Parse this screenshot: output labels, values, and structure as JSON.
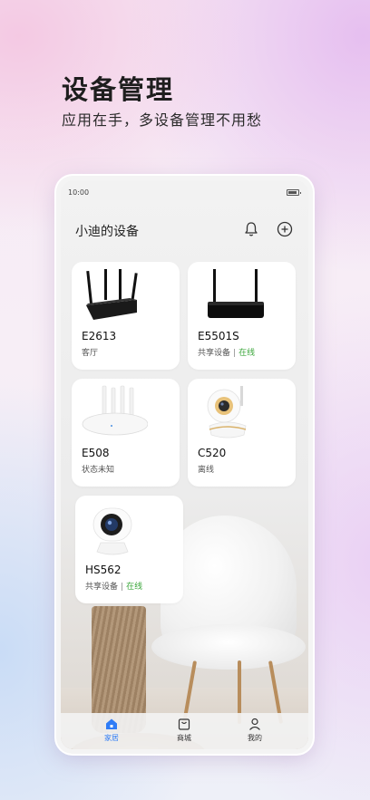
{
  "hero": {
    "title": "设备管理",
    "subtitle": "应用在手，多设备管理不用愁"
  },
  "status_bar": {
    "time": "10:00"
  },
  "header": {
    "title": "小迪的设备",
    "bell_icon": "bell-icon",
    "add_icon": "add-circle-icon"
  },
  "devices": [
    {
      "name": "E2613",
      "status": "客厅",
      "online": "",
      "image": "router-4-antenna-black"
    },
    {
      "name": "E5501S",
      "status": "共享设备",
      "online": "在线",
      "image": "router-2-antenna-black"
    },
    {
      "name": "E508",
      "status": "状态未知",
      "online": "",
      "image": "router-4-antenna-white"
    },
    {
      "name": "C520",
      "status": "离线",
      "online": "",
      "image": "camera-white-gold"
    },
    {
      "name": "HS562",
      "status": "共享设备",
      "online": "在线",
      "image": "camera-white-blue"
    }
  ],
  "tabbar": [
    {
      "label": "家居",
      "icon": "home-icon",
      "active": true
    },
    {
      "label": "商城",
      "icon": "shop-bag-icon",
      "active": false
    },
    {
      "label": "我的",
      "icon": "user-icon",
      "active": false
    }
  ],
  "colors": {
    "accent": "#2f7cf6",
    "online": "#3aa63a"
  }
}
